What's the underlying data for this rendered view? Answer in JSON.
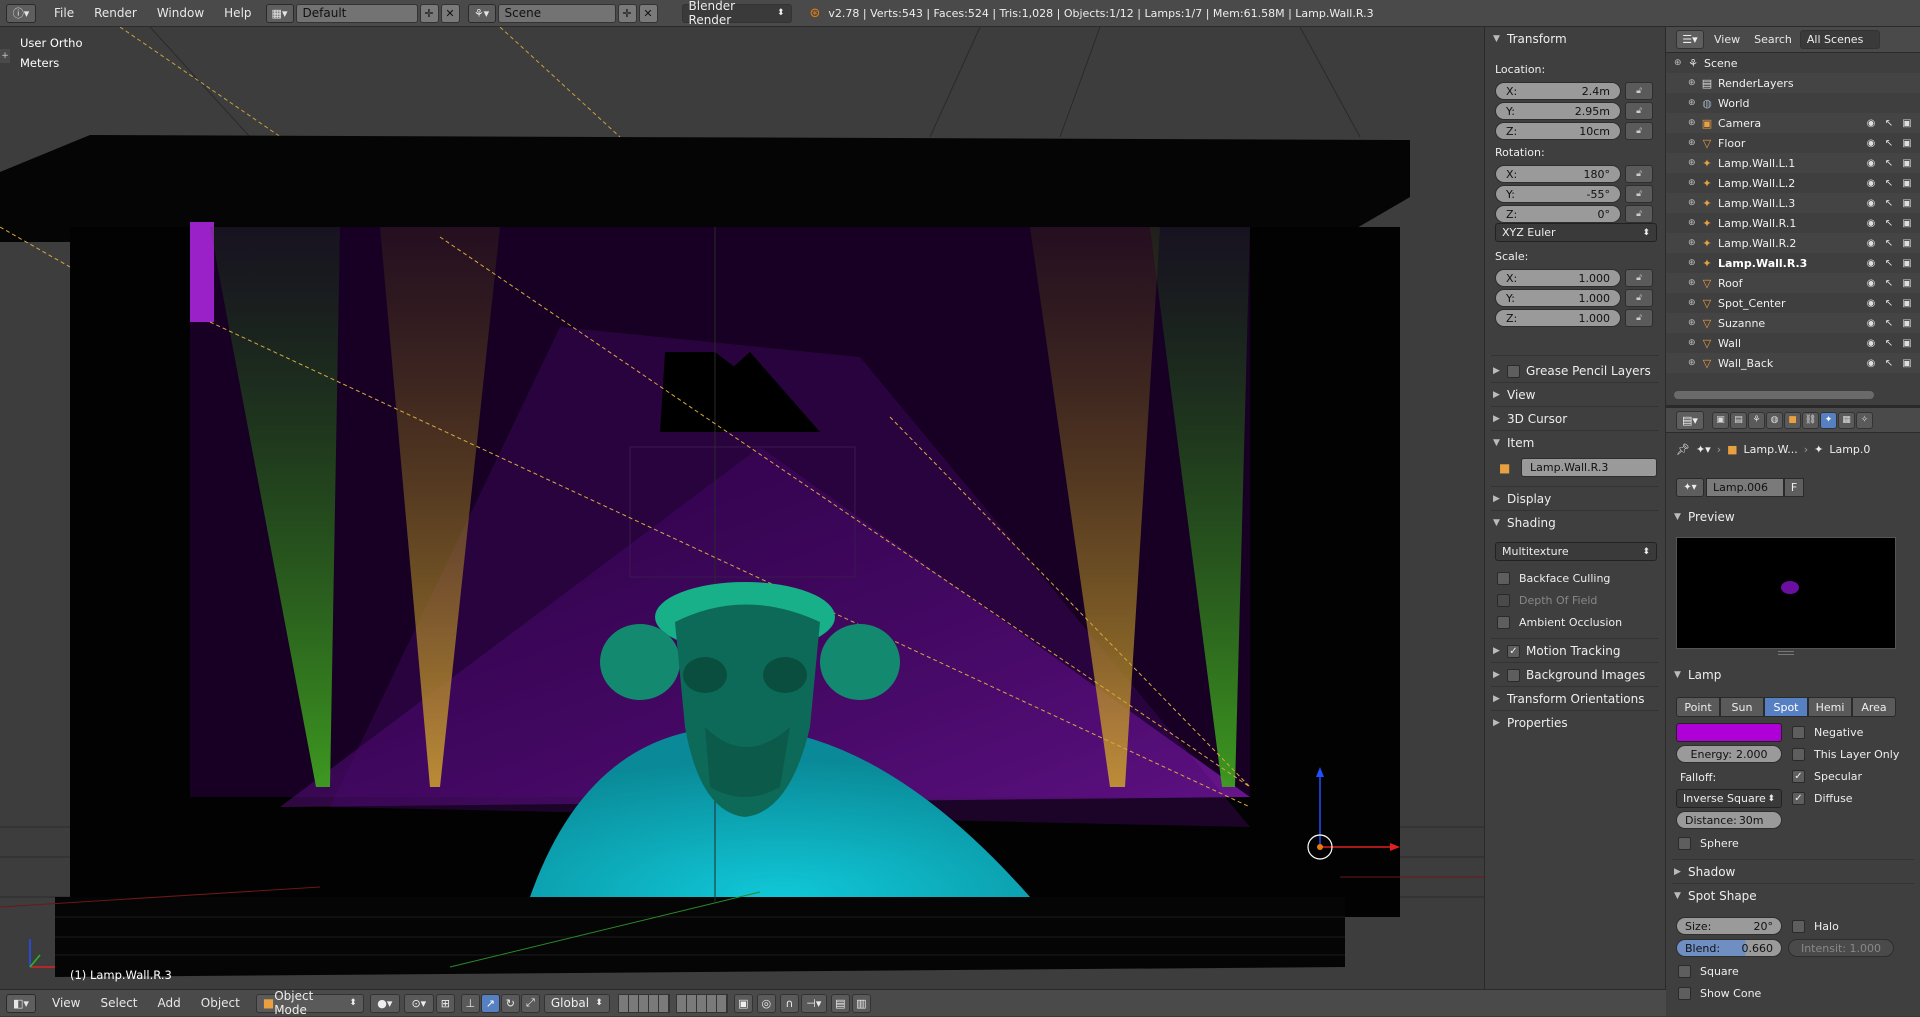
{
  "topbar": {
    "menus": [
      "File",
      "Render",
      "Window",
      "Help"
    ],
    "layout": "Default",
    "scene": "Scene",
    "engine": "Blender Render",
    "stats": "v2.78 | Verts:543 | Faces:524 | Tris:1,028 | Objects:1/12 | Lamps:1/7 | Mem:61.58M | Lamp.Wall.R.3"
  },
  "viewport": {
    "view_name": "User Ortho",
    "units": "Meters",
    "active_label": "(1) Lamp.Wall.R.3"
  },
  "bottombar": {
    "menus": [
      "View",
      "Select",
      "Add",
      "Object"
    ],
    "mode": "Object Mode",
    "orientation": "Global"
  },
  "npanel": {
    "transform": {
      "title": "Transform",
      "location_label": "Location:",
      "location": [
        {
          "axis": "X:",
          "value": "2.4m"
        },
        {
          "axis": "Y:",
          "value": "2.95m"
        },
        {
          "axis": "Z:",
          "value": "10cm"
        }
      ],
      "rotation_label": "Rotation:",
      "rotation": [
        {
          "axis": "X:",
          "value": "180°"
        },
        {
          "axis": "Y:",
          "value": "-55°"
        },
        {
          "axis": "Z:",
          "value": "0°"
        }
      ],
      "rotation_mode": "XYZ Euler",
      "scale_label": "Scale:",
      "scale": [
        {
          "axis": "X:",
          "value": "1.000"
        },
        {
          "axis": "Y:",
          "value": "1.000"
        },
        {
          "axis": "Z:",
          "value": "1.000"
        }
      ]
    },
    "sections": {
      "grease_pencil": "Grease Pencil Layers",
      "view": "View",
      "cursor": "3D Cursor",
      "item": "Item",
      "item_name": "Lamp.Wall.R.3",
      "display": "Display",
      "shading": "Shading",
      "shading_mode": "Multitexture",
      "backface": "Backface Culling",
      "dof": "Depth Of Field",
      "ao": "Ambient Occlusion",
      "motion": "Motion Tracking",
      "background": "Background Images",
      "orientations": "Transform Orientations",
      "properties": "Properties"
    }
  },
  "outliner": {
    "menus": [
      "View",
      "Search"
    ],
    "scope": "All Scenes",
    "items": [
      {
        "name": "Scene",
        "icon": "scene-icon",
        "indent": 0
      },
      {
        "name": "RenderLayers",
        "icon": "renderlayers-icon",
        "indent": 1
      },
      {
        "name": "World",
        "icon": "world-icon",
        "indent": 1
      },
      {
        "name": "Camera",
        "icon": "camera-icon",
        "indent": 1
      },
      {
        "name": "Floor",
        "icon": "mesh-icon",
        "indent": 1
      },
      {
        "name": "Lamp.Wall.L.1",
        "icon": "lamp-icon",
        "indent": 1
      },
      {
        "name": "Lamp.Wall.L.2",
        "icon": "lamp-icon",
        "indent": 1
      },
      {
        "name": "Lamp.Wall.L.3",
        "icon": "lamp-icon",
        "indent": 1
      },
      {
        "name": "Lamp.Wall.R.1",
        "icon": "lamp-icon",
        "indent": 1
      },
      {
        "name": "Lamp.Wall.R.2",
        "icon": "lamp-icon",
        "indent": 1
      },
      {
        "name": "Lamp.Wall.R.3",
        "icon": "lamp-icon",
        "indent": 1
      },
      {
        "name": "Roof",
        "icon": "mesh-icon",
        "indent": 1
      },
      {
        "name": "Spot_Center",
        "icon": "mesh-icon",
        "indent": 1
      },
      {
        "name": "Suzanne",
        "icon": "mesh-icon",
        "indent": 1
      },
      {
        "name": "Wall",
        "icon": "mesh-icon",
        "indent": 1
      },
      {
        "name": "Wall_Back",
        "icon": "mesh-icon",
        "indent": 1
      }
    ]
  },
  "properties": {
    "breadcrumb_object": "Lamp.W...",
    "breadcrumb_data": "Lamp.0",
    "datablock": "Lamp.006",
    "fake_user": "F",
    "preview_title": "Preview",
    "lamp_title": "Lamp",
    "lamp_types": [
      "Point",
      "Sun",
      "Spot",
      "Hemi",
      "Area"
    ],
    "active_type": "Spot",
    "lamp_color": "#b000d8",
    "negative": "Negative",
    "this_layer": "This Layer Only",
    "energy_label": "Energy:",
    "energy": "2.000",
    "specular": "Specular",
    "falloff_label": "Falloff:",
    "diffuse": "Diffuse",
    "falloff": "Inverse Square",
    "distance_label": "Distance:",
    "distance": "30m",
    "sphere": "Sphere",
    "shadow_title": "Shadow",
    "spot_title": "Spot Shape",
    "size_label": "Size:",
    "size": "20°",
    "halo": "Halo",
    "blend_label": "Blend:",
    "blend": "0.660",
    "intensity": "Intensit: 1.000",
    "square": "Square",
    "show_cone": "Show Cone"
  }
}
